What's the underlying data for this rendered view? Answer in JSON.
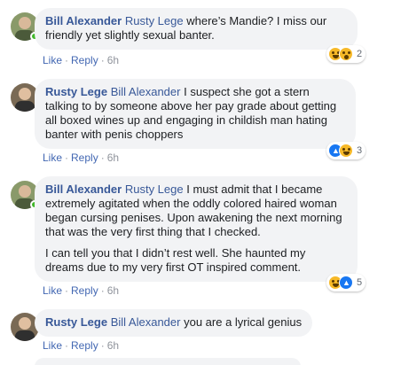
{
  "comments": [
    {
      "author": "Bill Alexander",
      "mention": "Rusty Lege",
      "paragraphs": [
        "where’s Mandie? I miss our friendly yet slightly sexual banter."
      ],
      "actions": {
        "like": "Like",
        "reply": "Reply",
        "time": "6h"
      },
      "reactions": {
        "icons": [
          "haha-icon",
          "wow-icon"
        ],
        "count": "2"
      }
    },
    {
      "author": "Rusty Lege",
      "mention": "Bill Alexander",
      "paragraphs": [
        "I suspect she got a stern talking to by someone above her pay grade about getting all boxed wines up and engaging in childish man hating banter with penis choppers"
      ],
      "actions": {
        "like": "Like",
        "reply": "Reply",
        "time": "6h"
      },
      "reactions": {
        "icons": [
          "like-icon",
          "haha-icon"
        ],
        "count": "3"
      }
    },
    {
      "author": "Bill Alexander",
      "mention": "Rusty Lege",
      "paragraphs": [
        "I must admit that I became extremely agitated when the oddly colored haired woman began cursing penises. Upon awakening the next morning that was the very first thing that I checked.",
        "I can tell you that I didn’t rest well. She haunted my dreams due to my very first OT inspired comment."
      ],
      "actions": {
        "like": "Like",
        "reply": "Reply",
        "time": "6h"
      },
      "reactions": {
        "icons": [
          "haha-icon",
          "like-icon"
        ],
        "count": "5"
      }
    },
    {
      "author": "Rusty Lege",
      "mention": "Bill Alexander",
      "paragraphs": [
        "you are a lyrical genius"
      ],
      "actions": {
        "like": "Like",
        "reply": "Reply",
        "time": "6h"
      }
    }
  ],
  "colors": {
    "name_link": "#385898",
    "bubble_bg": "#f2f3f5",
    "action_link": "#4267b2",
    "online": "#42b72a"
  }
}
